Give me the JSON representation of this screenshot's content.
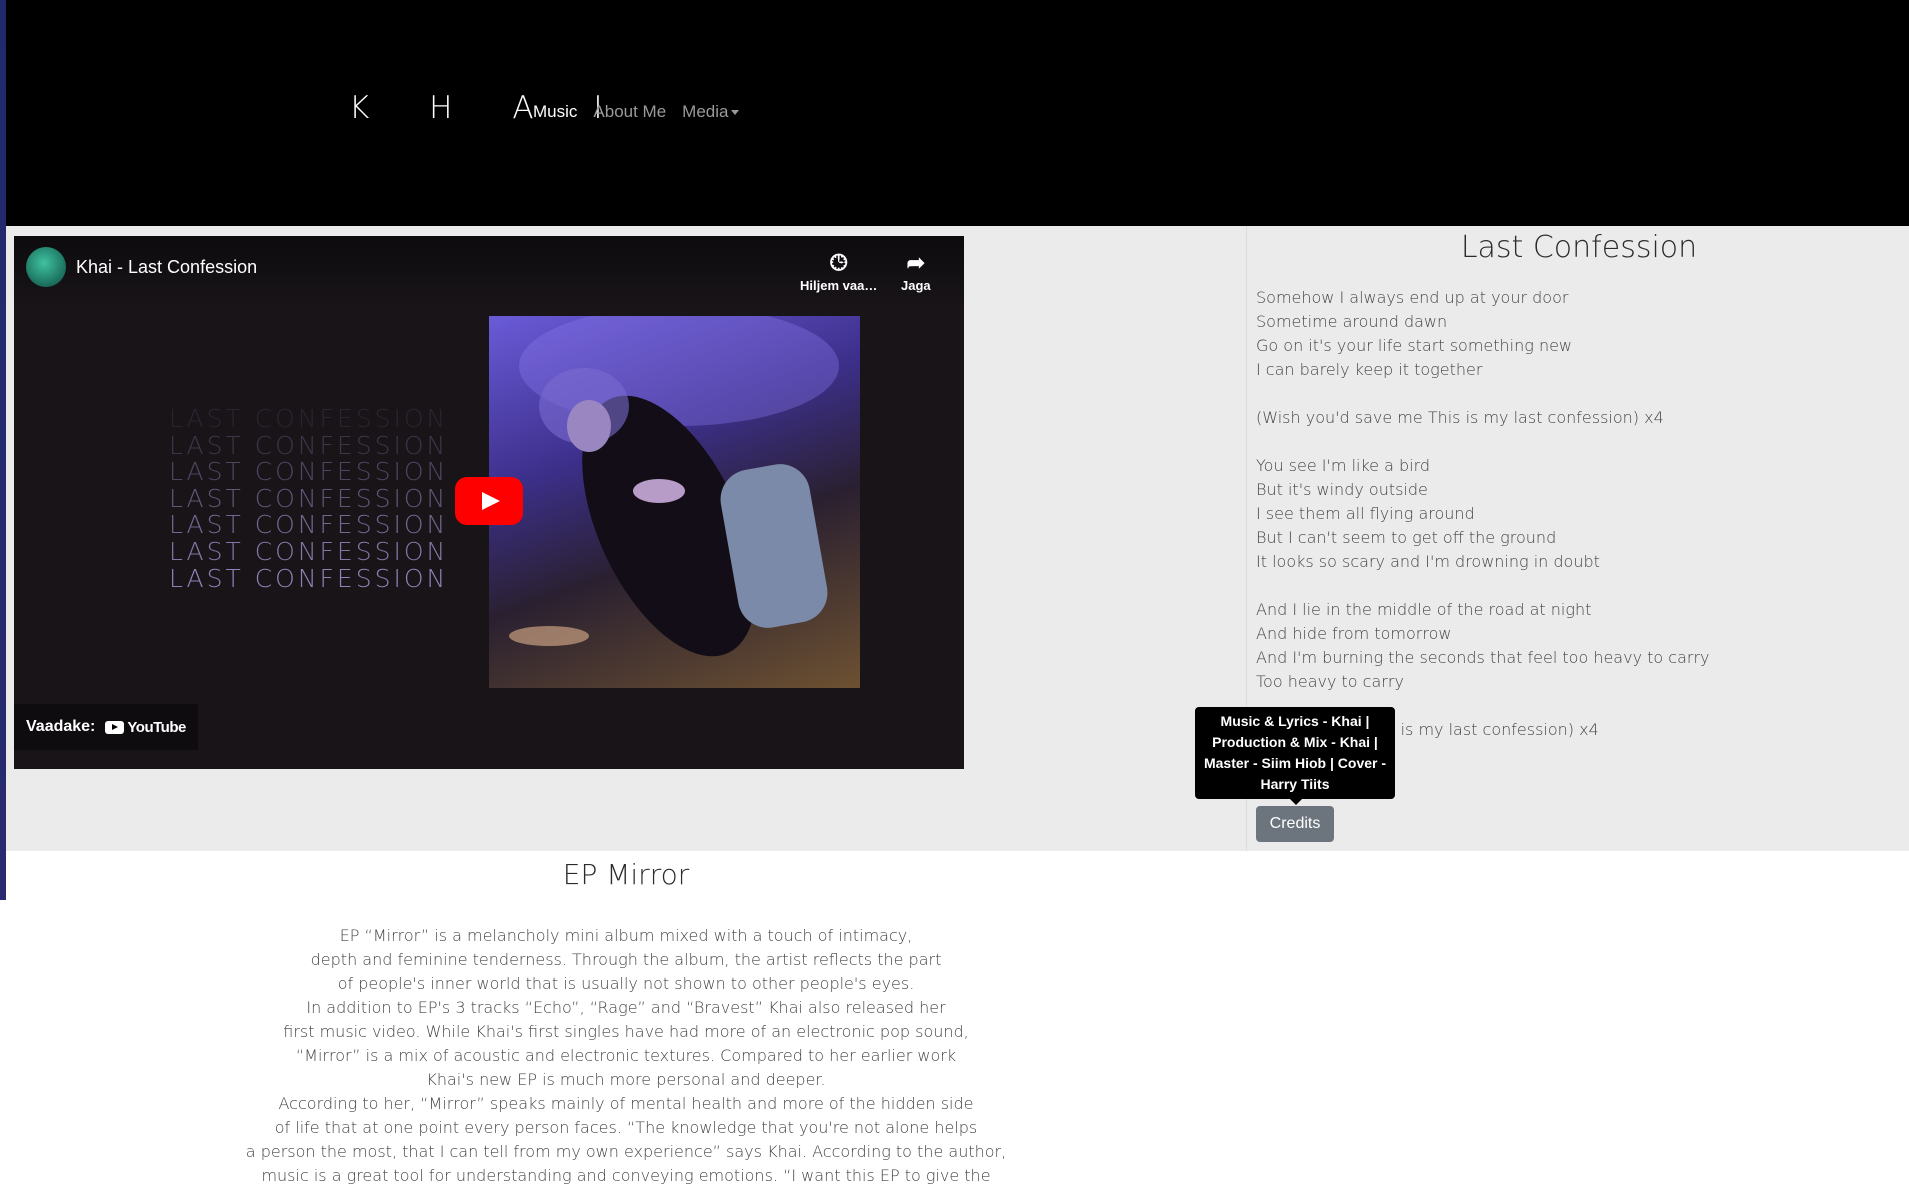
{
  "nav": {
    "brand": "K H A I",
    "items": [
      {
        "label": "Music",
        "active": true
      },
      {
        "label": "About Me",
        "active": false
      },
      {
        "label": "Media",
        "active": false,
        "dropdown": true
      }
    ]
  },
  "video": {
    "title": "Khai - Last Confession",
    "watch_later_label": "Hiljem vaa…",
    "share_label": "Jaga",
    "watch_on_label": "Vaadake:",
    "platform": "YouTube",
    "art_text": [
      "LAST CONFESSION",
      "LAST CONFESSION",
      "LAST CONFESSION",
      "LAST CONFESSION",
      "LAST CONFESSION",
      "LAST CONFESSION",
      "LAST CONFESSION"
    ],
    "accent_color": "#ff0000"
  },
  "lyrics": {
    "title": "Last Confession",
    "lines": [
      "Somehow I always end up at your door",
      "Sometime around dawn",
      "Go on it's your life start something new",
      "I can barely keep it together",
      "",
      "(Wish you'd save me This is my last confession) x4",
      "",
      "You see I'm like a bird",
      "But it's windy outside",
      "I see them all flying around",
      "But I can't seem to get off the ground",
      "It looks so scary and I'm drowning in doubt",
      "",
      "And I lie in the middle of the road at night",
      "And hide from tomorrow",
      "And I'm burning the seconds that feel too heavy to carry",
      "Too heavy to carry",
      "",
      "               me This is my last confession) x4",
      "               me) x4"
    ],
    "credits_button": "Credits",
    "credits_tooltip": "Music & Lyrics - Khai | Production & Mix - Khai | Master - Siim Hiob | Cover - Harry Tiits"
  },
  "ep": {
    "title": "EP Mirror",
    "lines": [
      "EP “Mirror” is a melancholy mini album mixed with a touch of intimacy,",
      "depth and feminine tenderness. Through the album, the artist reflects the part",
      "of people's inner world that is usually not shown to other people's eyes.",
      "In addition to EP's 3 tracks “Echo”, “Rage” and “Bravest” Khai also released her",
      "first music video. While Khai's first singles have had more of an electronic pop sound,",
      "“Mirror” is a mix of acoustic and electronic textures. Compared to her earlier work",
      "Khai's new EP is much more personal and deeper.",
      "According to her, “Mirror” speaks mainly of mental health and more of the hidden side",
      "of life that at one point every person faces. “The knowledge that you're not alone helps",
      "a person the most, that I can tell from my own experience” says Khai. According to the author,",
      "music is a great tool for understanding and conveying emotions. “I want this EP to give the"
    ]
  }
}
